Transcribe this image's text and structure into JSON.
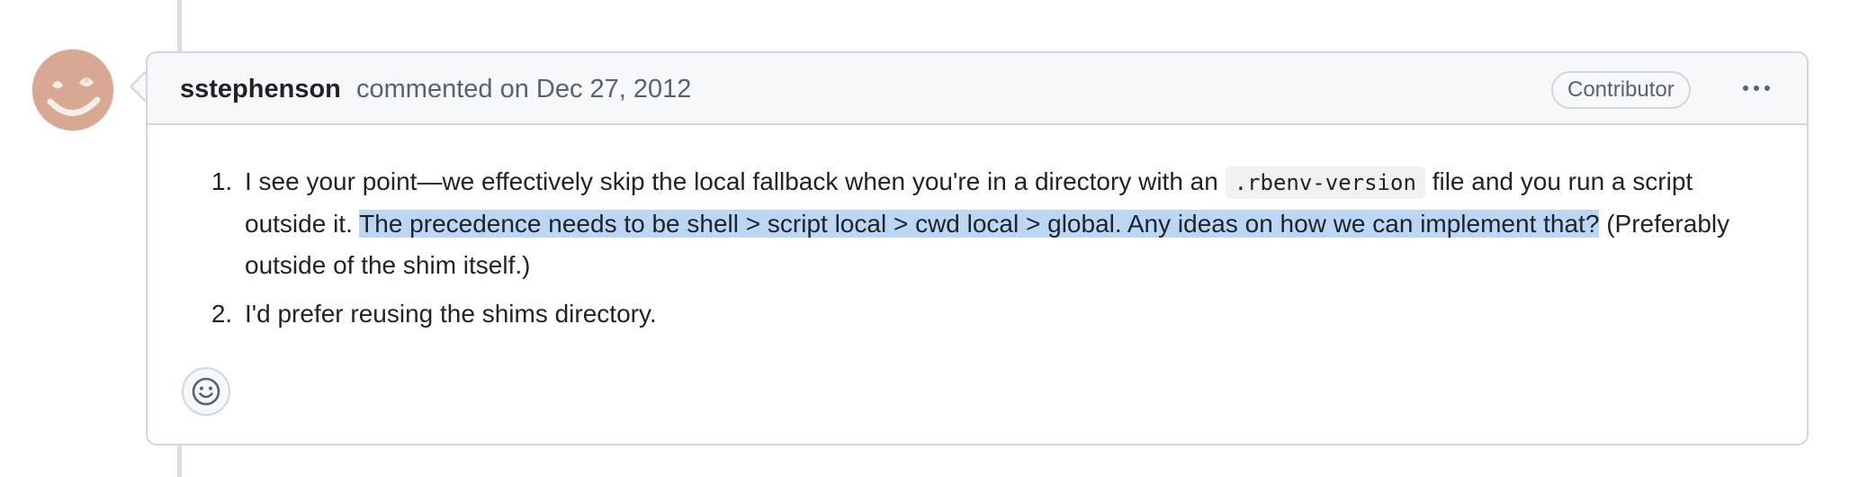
{
  "comment": {
    "author": "sstephenson",
    "meta": "commented on Dec 27, 2012",
    "badge": "Contributor",
    "more_options_icon": "kebab-horizontal-icon",
    "items": [
      {
        "text_before": "I see your point—we effectively skip the local fallback when you're in a directory with an",
        "code": ".rbenv-version",
        "text_after": "file and you run a script outside it.",
        "highlighted": "The precedence needs to be shell > script local > cwd local > global. Any ideas on how we can implement that?",
        "text_end": "(Preferably outside of the shim itself.)"
      },
      {
        "text": "I'd prefer reusing the shims directory."
      }
    ],
    "reaction_icon": "smiley-icon"
  },
  "colors": {
    "border": "#d0d7de",
    "header_bg": "#f6f8fa",
    "highlight": "#bcd6f6",
    "muted_text": "#59636e"
  }
}
